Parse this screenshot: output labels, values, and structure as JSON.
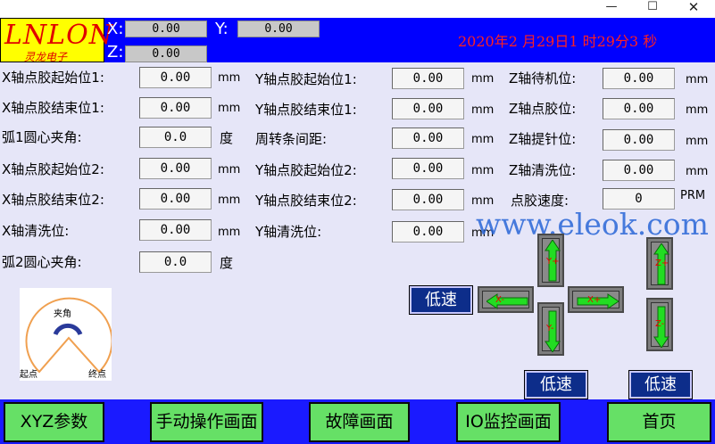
{
  "window": {
    "minimize_icon": "minimize-icon",
    "maximize_icon": "maximize-icon",
    "close_icon": "close-icon"
  },
  "logo": {
    "main": "LNLON",
    "sub": "灵龙电子"
  },
  "header": {
    "x_label": "X:",
    "x_value": "0.00",
    "y_label": "Y:",
    "y_value": "0.00",
    "z_label": "Z:",
    "z_value": "0.00",
    "datetime": "2020年2 月29日1 时29分3 秒"
  },
  "params": {
    "x_start1": {
      "label": "X轴点胶起始位1:",
      "value": "0.00",
      "unit": "mm"
    },
    "x_end1": {
      "label": "X轴点胶结束位1:",
      "value": "0.00",
      "unit": "mm"
    },
    "arc1": {
      "label": "弧1圆心夹角:",
      "value": "0.0",
      "unit": "度"
    },
    "x_start2": {
      "label": "X轴点胶起始位2:",
      "value": "0.00",
      "unit": "mm"
    },
    "x_end2": {
      "label": "X轴点胶结束位2:",
      "value": "0.00",
      "unit": "mm"
    },
    "x_clean": {
      "label": "X轴清洗位:",
      "value": "0.00",
      "unit": "mm"
    },
    "arc2": {
      "label": "弧2圆心夹角:",
      "value": "0.0",
      "unit": "度"
    },
    "y_start1": {
      "label": "Y轴点胶起始位1:",
      "value": "0.00",
      "unit": "mm"
    },
    "y_end1": {
      "label": "Y轴点胶结束位1:",
      "value": "0.00",
      "unit": "mm"
    },
    "cycle_pitch": {
      "label": "周转条间距:",
      "value": "0.00",
      "unit": "mm"
    },
    "y_start2": {
      "label": "Y轴点胶起始位2:",
      "value": "0.00",
      "unit": "mm"
    },
    "y_end2": {
      "label": "Y轴点胶结束位2:",
      "value": "0.00",
      "unit": "mm"
    },
    "y_clean": {
      "label": "Y轴清洗位:",
      "value": "0.00",
      "unit": "mm"
    },
    "z_standby": {
      "label": "Z轴待机位:",
      "value": "0.00",
      "unit": "mm"
    },
    "z_dispense": {
      "label": "Z轴点胶位:",
      "value": "0.00",
      "unit": "mm"
    },
    "z_lift": {
      "label": "Z轴提针位:",
      "value": "0.00",
      "unit": "mm"
    },
    "z_clean": {
      "label": "Z轴清洗位:",
      "value": "0.00",
      "unit": "mm"
    },
    "speed": {
      "label": "点胶速度:",
      "value": "0",
      "unit": "PRM"
    }
  },
  "watermark": "www.eleok.com",
  "jog": {
    "slow_xy": "低速",
    "slow_y": "低速",
    "slow_z": "低速",
    "x_minus": "X-",
    "x_plus": "X+",
    "y_plus": "Y+",
    "y_minus": "Y-",
    "z_plus": "Z+",
    "z_minus": "Z-",
    "arrow_color": "#22dd22"
  },
  "diagram": {
    "angle_label": "夹角",
    "start_label": "起点",
    "end_label": "终点",
    "stroke_color": "#f0a050"
  },
  "nav": [
    {
      "label": "XYZ参数"
    },
    {
      "label": "手动操作画面"
    },
    {
      "label": "故障画面"
    },
    {
      "label": "IO监控画面"
    },
    {
      "label": "首页"
    }
  ],
  "colors": {
    "header_bg": "#0000ff",
    "nav_bg": "#1a1aff",
    "nav_btn": "#66e066",
    "logo_bg": "#ffff00",
    "logo_text": "#e00000",
    "datetime": "#ff2020"
  }
}
